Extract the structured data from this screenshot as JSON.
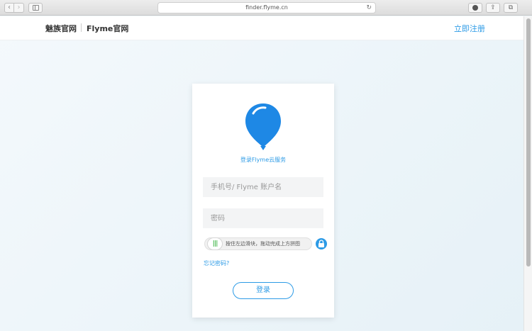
{
  "browser": {
    "url": "finder.flyme.cn",
    "back_label": "‹",
    "forward_label": "›",
    "reload_label": "↻",
    "share_label": "⇪",
    "tabs_label": "⧉"
  },
  "header": {
    "brand_primary": "魅族官网",
    "brand_secondary": "Flyme官网",
    "register_label": "立即注册"
  },
  "login": {
    "subtitle": "登录Flyme云服务",
    "account_placeholder": "手机号/ Flyme 账户名",
    "password_placeholder": "密码",
    "slider_handle": "|||",
    "slider_hint": "按住左边滑块，拖动完成上方拼图",
    "forgot_label": "忘记密码?",
    "submit_label": "登录"
  },
  "colors": {
    "accent": "#2d9be6",
    "slider_grip": "#48b84e"
  },
  "icons": {
    "logo": "flyme-balloon-icon",
    "lock": "lock-icon",
    "download": "download-icon"
  }
}
